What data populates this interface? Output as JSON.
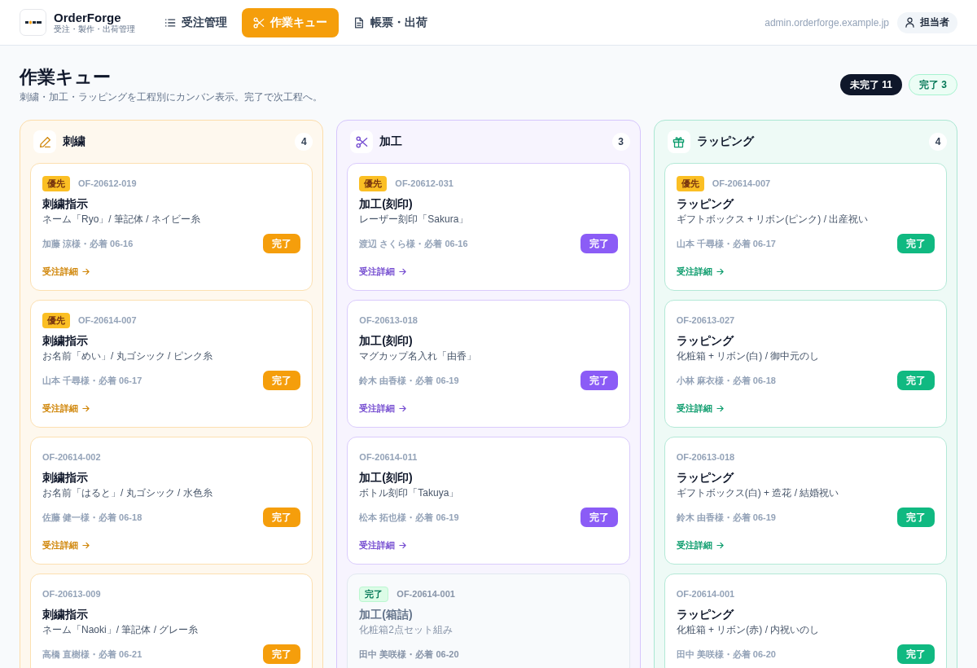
{
  "header": {
    "app_name": "OrderForge",
    "app_subtitle": "受注・製作・出荷管理",
    "tabs": [
      {
        "label": "受注管理",
        "selected": false
      },
      {
        "label": "作業キュー",
        "selected": true
      },
      {
        "label": "帳票・出荷",
        "selected": false
      }
    ],
    "domain": "admin.orderforge.example.jp",
    "user": "担当者"
  },
  "page": {
    "title": "作業キュー",
    "subtitle": "刺繍・加工・ラッピングを工程別にカンバン表示。完了で次工程へ。",
    "summary": [
      {
        "label": "未完了 11",
        "kind": "pending"
      },
      {
        "label": "完了 3",
        "kind": "done"
      }
    ]
  },
  "columns": [
    {
      "title": "刺繍",
      "count": "4",
      "color": "#f59e0b",
      "cards": [
        {
          "badge": "優先",
          "id": "OF-20612-019",
          "title": "刺繍指示",
          "detail": "ネーム「Ryo」/ 筆記体 / ネイビー糸",
          "meta": "加藤 涼様・必着 06-16",
          "action": "完了",
          "link": "受注詳細",
          "done": false
        },
        {
          "badge": "優先",
          "id": "OF-20614-007",
          "title": "刺繍指示",
          "detail": "お名前「めい」/ 丸ゴシック / ピンク糸",
          "meta": "山本 千尋様・必着 06-17",
          "action": "完了",
          "link": "受注詳細",
          "done": false
        },
        {
          "id": "OF-20614-002",
          "title": "刺繍指示",
          "detail": "お名前「はると」/ 丸ゴシック / 水色糸",
          "meta": "佐藤 健一様・必着 06-18",
          "action": "完了",
          "link": "受注詳細",
          "done": false
        },
        {
          "id": "OF-20613-009",
          "title": "刺繍指示",
          "detail": "ネーム「Naoki」/ 筆記体 / グレー糸",
          "meta": "高橋 直樹様・必着 06-21",
          "action": "完了",
          "done": false
        }
      ]
    },
    {
      "title": "加工",
      "count": "3",
      "color": "#8b5cf6",
      "cards": [
        {
          "badge": "優先",
          "id": "OF-20612-031",
          "title": "加工(刻印)",
          "detail": "レーザー刻印「Sakura」",
          "meta": "渡辺 さくら様・必着 06-16",
          "action": "完了",
          "link": "受注詳細",
          "done": false
        },
        {
          "id": "OF-20613-018",
          "title": "加工(刻印)",
          "detail": "マグカップ名入れ「由香」",
          "meta": "鈴木 由香様・必着 06-19",
          "action": "完了",
          "link": "受注詳細",
          "done": false
        },
        {
          "id": "OF-20614-011",
          "title": "加工(刻印)",
          "detail": "ボトル刻印「Takuya」",
          "meta": "松本 拓也様・必着 06-19",
          "action": "完了",
          "link": "受注詳細",
          "done": false
        },
        {
          "badge": "完了",
          "id": "OF-20614-001",
          "title": "加工(箱詰)",
          "detail": "化粧箱2点セット組み",
          "meta": "田中 美咲様・必着 06-20",
          "done": true
        }
      ]
    },
    {
      "title": "ラッピング",
      "count": "4",
      "color": "#10b981",
      "cards": [
        {
          "badge": "優先",
          "id": "OF-20614-007",
          "title": "ラッピング",
          "detail": "ギフトボックス + リボン(ピンク) / 出産祝い",
          "meta": "山本 千尋様・必着 06-17",
          "action": "完了",
          "link": "受注詳細",
          "done": false
        },
        {
          "id": "OF-20613-027",
          "title": "ラッピング",
          "detail": "化粧箱 + リボン(白) / 御中元のし",
          "meta": "小林 麻衣様・必着 06-18",
          "action": "完了",
          "link": "受注詳細",
          "done": false
        },
        {
          "id": "OF-20613-018",
          "title": "ラッピング",
          "detail": "ギフトボックス(白) + 造花 / 結婚祝い",
          "meta": "鈴木 由香様・必着 06-19",
          "action": "完了",
          "link": "受注詳細",
          "done": false
        },
        {
          "id": "OF-20614-001",
          "title": "ラッピング",
          "detail": "化粧箱 + リボン(赤) / 内祝いのし",
          "meta": "田中 美咲様・必着 06-20",
          "action": "完了",
          "done": false
        }
      ]
    }
  ]
}
